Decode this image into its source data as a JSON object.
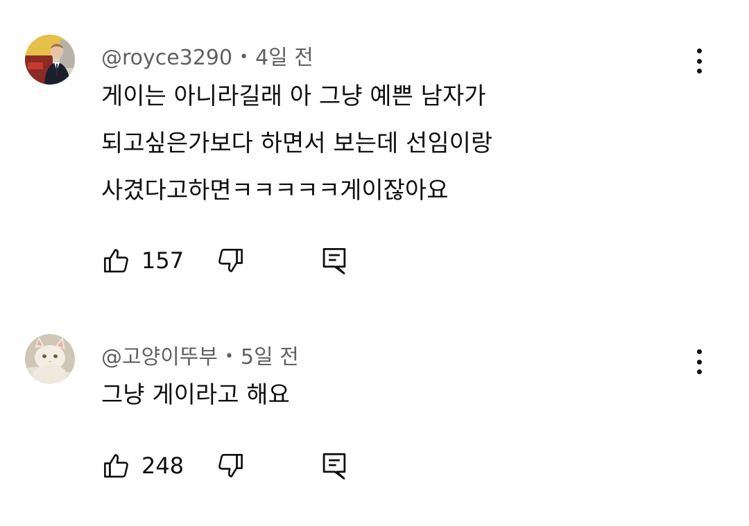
{
  "comments": [
    {
      "author": "@royce3290",
      "separator": "•",
      "time": "4일 전",
      "lines": [
        "게이는 아니라길래 아 그냥 예쁜 남자가",
        "되고싶은가보다 하면서 보는데 선임이랑",
        "사겼다고하면ㅋㅋㅋㅋㅋ게이잖아요"
      ],
      "likes": "157",
      "avatar_icon": "person-photo-avatar"
    },
    {
      "author": "@고양이뚜부",
      "separator": "•",
      "time": "5일 전",
      "lines": [
        "그냥 게이라고 해요"
      ],
      "likes": "248",
      "avatar_icon": "cat-photo-avatar"
    }
  ],
  "icons": {
    "like": "thumb-up-icon",
    "dislike": "thumb-down-icon",
    "reply": "reply-comment-icon",
    "menu": "more-vertical-icon"
  },
  "colors": {
    "text": "#0f0f0f",
    "meta": "#606060",
    "background": "#ffffff"
  }
}
